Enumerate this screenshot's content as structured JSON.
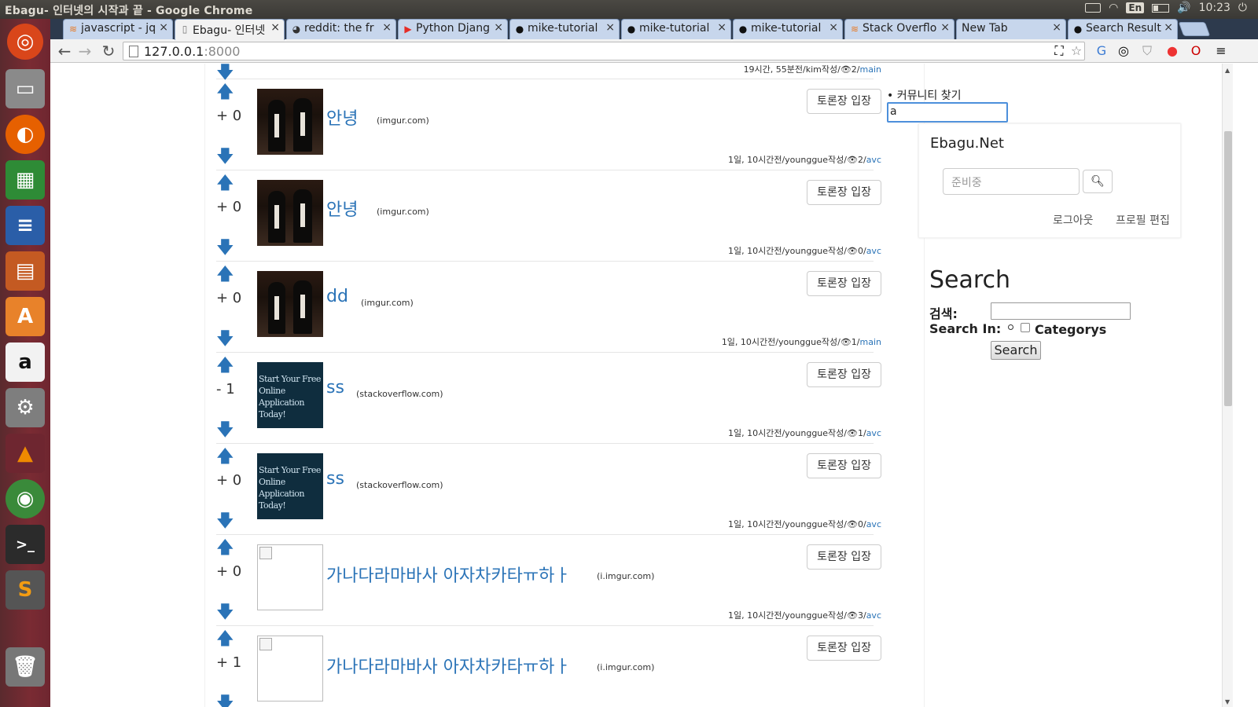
{
  "os": {
    "window_title": "Ebagu- 인터넷의 시작과 끝 - Google Chrome",
    "keyboard_lang": "En",
    "clock": "10:23"
  },
  "browser": {
    "tabs": [
      {
        "label": "javascript - jq",
        "icon": "stackoverflow-icon"
      },
      {
        "label": "Ebagu- 인터넷",
        "icon": "page-icon"
      },
      {
        "label": "reddit: the fr",
        "icon": "reddit-icon"
      },
      {
        "label": "Python Djang",
        "icon": "youtube-icon"
      },
      {
        "label": "mike-tutorial",
        "icon": "github-icon"
      },
      {
        "label": "mike-tutorial",
        "icon": "github-icon"
      },
      {
        "label": "mike-tutorial",
        "icon": "github-icon"
      },
      {
        "label": "Stack Overflo",
        "icon": "stackoverflow-icon"
      },
      {
        "label": "New Tab",
        "icon": ""
      },
      {
        "label": "Search Result",
        "icon": "github-icon"
      }
    ],
    "url_host": "127.0.0.1",
    "url_port": ":8000"
  },
  "feed": {
    "top_meta": {
      "text": "19시간, 55분전/kim작성/",
      "views": "2",
      "sub": "main"
    },
    "posts": [
      {
        "score": "+ 0",
        "title": "안녕",
        "domain": "(imgur.com)",
        "discuss": "토론장 입장",
        "meta": "1일, 10시간전/younggue작성/",
        "views": "2",
        "sub": "avc",
        "thumb": "movie"
      },
      {
        "score": "+ 0",
        "title": "안녕",
        "domain": "(imgur.com)",
        "discuss": "토론장 입장",
        "meta": "1일, 10시간전/younggue작성/",
        "views": "0",
        "sub": "avc",
        "thumb": "movie"
      },
      {
        "score": "+ 0",
        "title": "dd",
        "domain": "(imgur.com)",
        "discuss": "토론장 입장",
        "meta": "1일, 10시간전/younggue작성/",
        "views": "1",
        "sub": "main",
        "thumb": "movie"
      },
      {
        "score": "- 1",
        "title": "ss",
        "domain": "(stackoverflow.com)",
        "discuss": "토론장 입장",
        "meta": "1일, 10시간전/younggue작성/",
        "views": "1",
        "sub": "avc",
        "thumb": "adv",
        "thumb_text": "Start Your Free Online Application Today!"
      },
      {
        "score": "+ 0",
        "title": "ss",
        "domain": "(stackoverflow.com)",
        "discuss": "토론장 입장",
        "meta": "1일, 10시간전/younggue작성/",
        "views": "0",
        "sub": "avc",
        "thumb": "adv",
        "thumb_text": "Start Your Free Online Application Today!"
      },
      {
        "score": "+ 0",
        "title": "가나다라마바사 아자차카타ㅠ하ㅏ",
        "domain": "(i.imgur.com)",
        "discuss": "토론장 입장",
        "meta": "1일, 10시간전/younggue작성/",
        "views": "3",
        "sub": "avc",
        "thumb": "broken"
      },
      {
        "score": "+ 1",
        "title": "가나다라마바사 아자차카타ㅠ하ㅏ",
        "domain": "(i.imgur.com)",
        "discuss": "토론장 입장",
        "meta": "",
        "views": "",
        "sub": "",
        "thumb": "broken"
      }
    ]
  },
  "sidebar": {
    "community_label": "커뮤니티 찾기",
    "community_value": "a",
    "brand": "Ebagu.Net",
    "search_placeholder": "준비중",
    "logout": "로그아웃",
    "edit_profile": "프로필 편집",
    "search_heading": "Search",
    "search_label": "검색:",
    "search_in_label": "Search In:",
    "category_label": "Categorys",
    "search_button": "Search"
  },
  "colors": {
    "link": "#2a73b7",
    "launcher": "#7a2b33",
    "tab_bg": "#c7d6ec"
  }
}
